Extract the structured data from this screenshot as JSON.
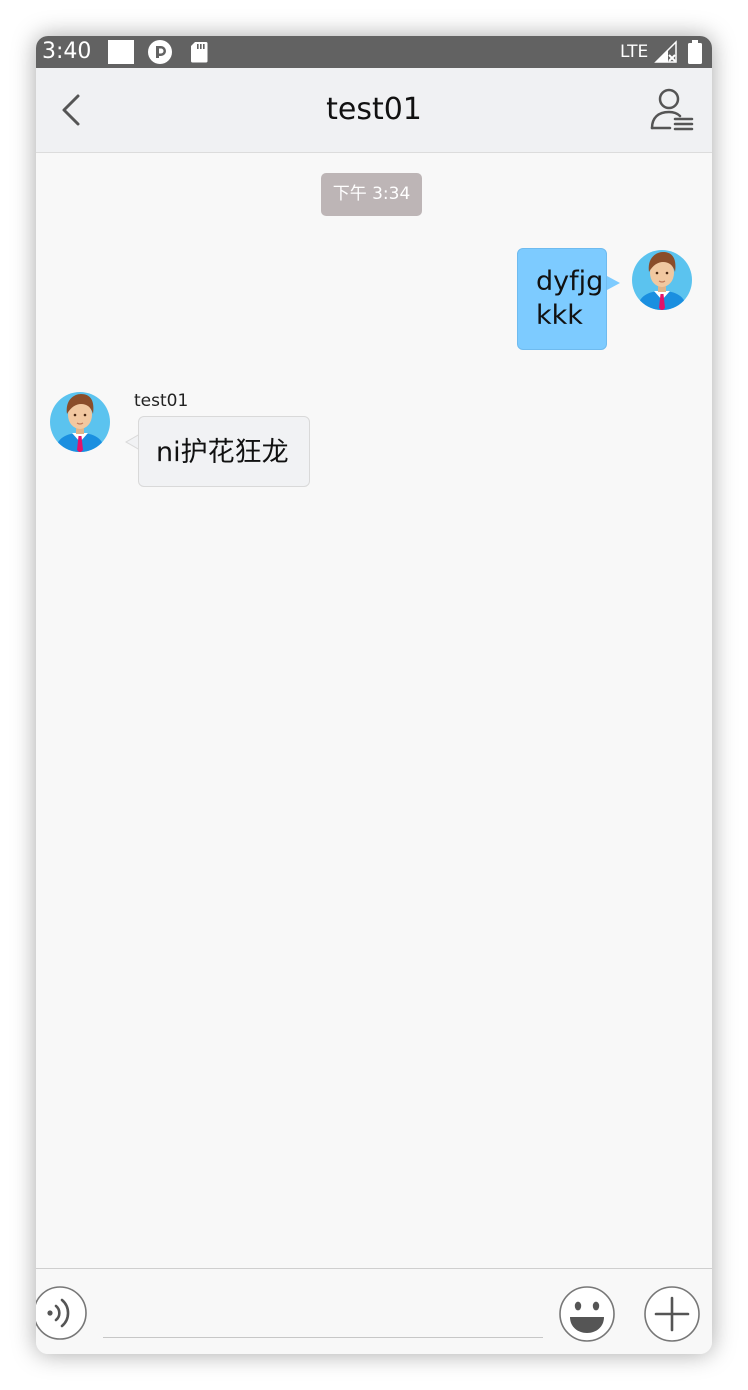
{
  "status_bar": {
    "time": "3:40",
    "network": "LTE",
    "icons": [
      "notification-square-icon",
      "app-circle-icon",
      "sd-card-icon",
      "signal-icon",
      "battery-icon"
    ]
  },
  "header": {
    "title": "test01",
    "back_icon": "chevron-left-icon",
    "profile_icon": "user-menu-icon"
  },
  "chat": {
    "timestamp": "下午 3:34",
    "messages": [
      {
        "direction": "outgoing",
        "lines": [
          "dyfjg",
          "kkk"
        ]
      },
      {
        "direction": "incoming",
        "sender": "test01",
        "text": "ni护花狂龙"
      }
    ]
  },
  "input_bar": {
    "value": "",
    "placeholder": "",
    "voice_icon": "voice-icon",
    "emoji_icon": "emoji-icon",
    "plus_icon": "plus-icon"
  },
  "colors": {
    "status_bar": "#626262",
    "header_bg": "#f0f1f3",
    "chat_bg": "#f8f8f8",
    "outgoing_bubble": "#7dcbff",
    "incoming_bubble": "#f1f2f4",
    "timestamp_pill": "#bdb5b6"
  }
}
